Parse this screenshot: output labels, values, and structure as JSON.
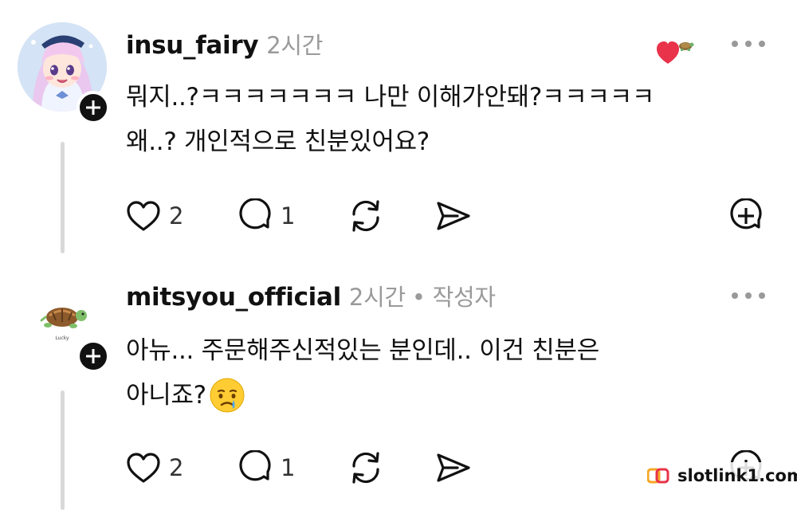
{
  "posts": [
    {
      "username": "insu_fairy",
      "time": "2시간",
      "author_tag": "",
      "line1": "뭐지..?ㅋㅋㅋㅋㅋㅋㅋ 나만 이해가안돼?ㅋㅋㅋㅋㅋ",
      "line2": "왜..? 개인적으로 친분있어요?",
      "likes": "2",
      "replies": "1"
    },
    {
      "username": "mitsyou_official",
      "time": "2시간",
      "author_tag": "• 작성자",
      "line1": "아뉴... 주문해주신적있는 분인데.. 이건 친분은",
      "line2": "아니죠?",
      "emoji": "😢",
      "likes": "2",
      "replies": "1"
    }
  ],
  "watermark": {
    "text": "slotlink1.com"
  },
  "colors": {
    "heart_badge": "#e8334a",
    "thread_line": "#d9d9d9",
    "meta_gray": "#9a9a9a"
  }
}
